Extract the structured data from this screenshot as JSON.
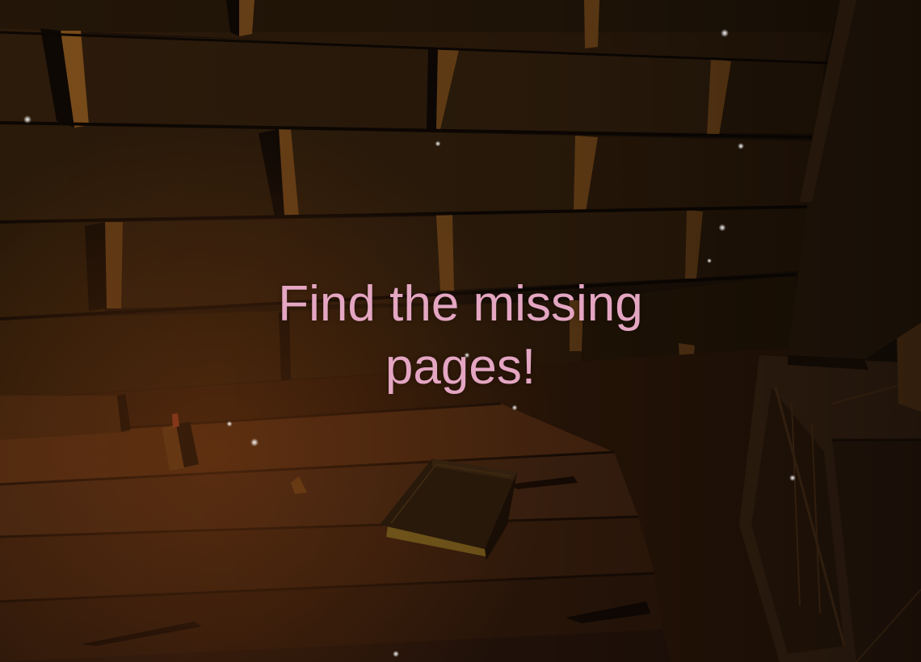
{
  "hud": {
    "objective_text": "Find the missing pages!"
  },
  "scene": {
    "setting": "dim wooden attic",
    "objects": [
      "wooden plank wall",
      "wooden floor",
      "closed book",
      "wooden crate",
      "candle stub",
      "floating dust motes"
    ]
  },
  "colors": {
    "objective_text": "#e4a6c2",
    "wall_wood": "#2a1a0b",
    "wall_highlight": "#6b4217",
    "floor_wood": "#3e2210",
    "book_cover": "#2e1c0c",
    "book_pages": "#7a5c1c",
    "crate_wood": "#3a2413",
    "dust_mote": "#ffffff"
  }
}
